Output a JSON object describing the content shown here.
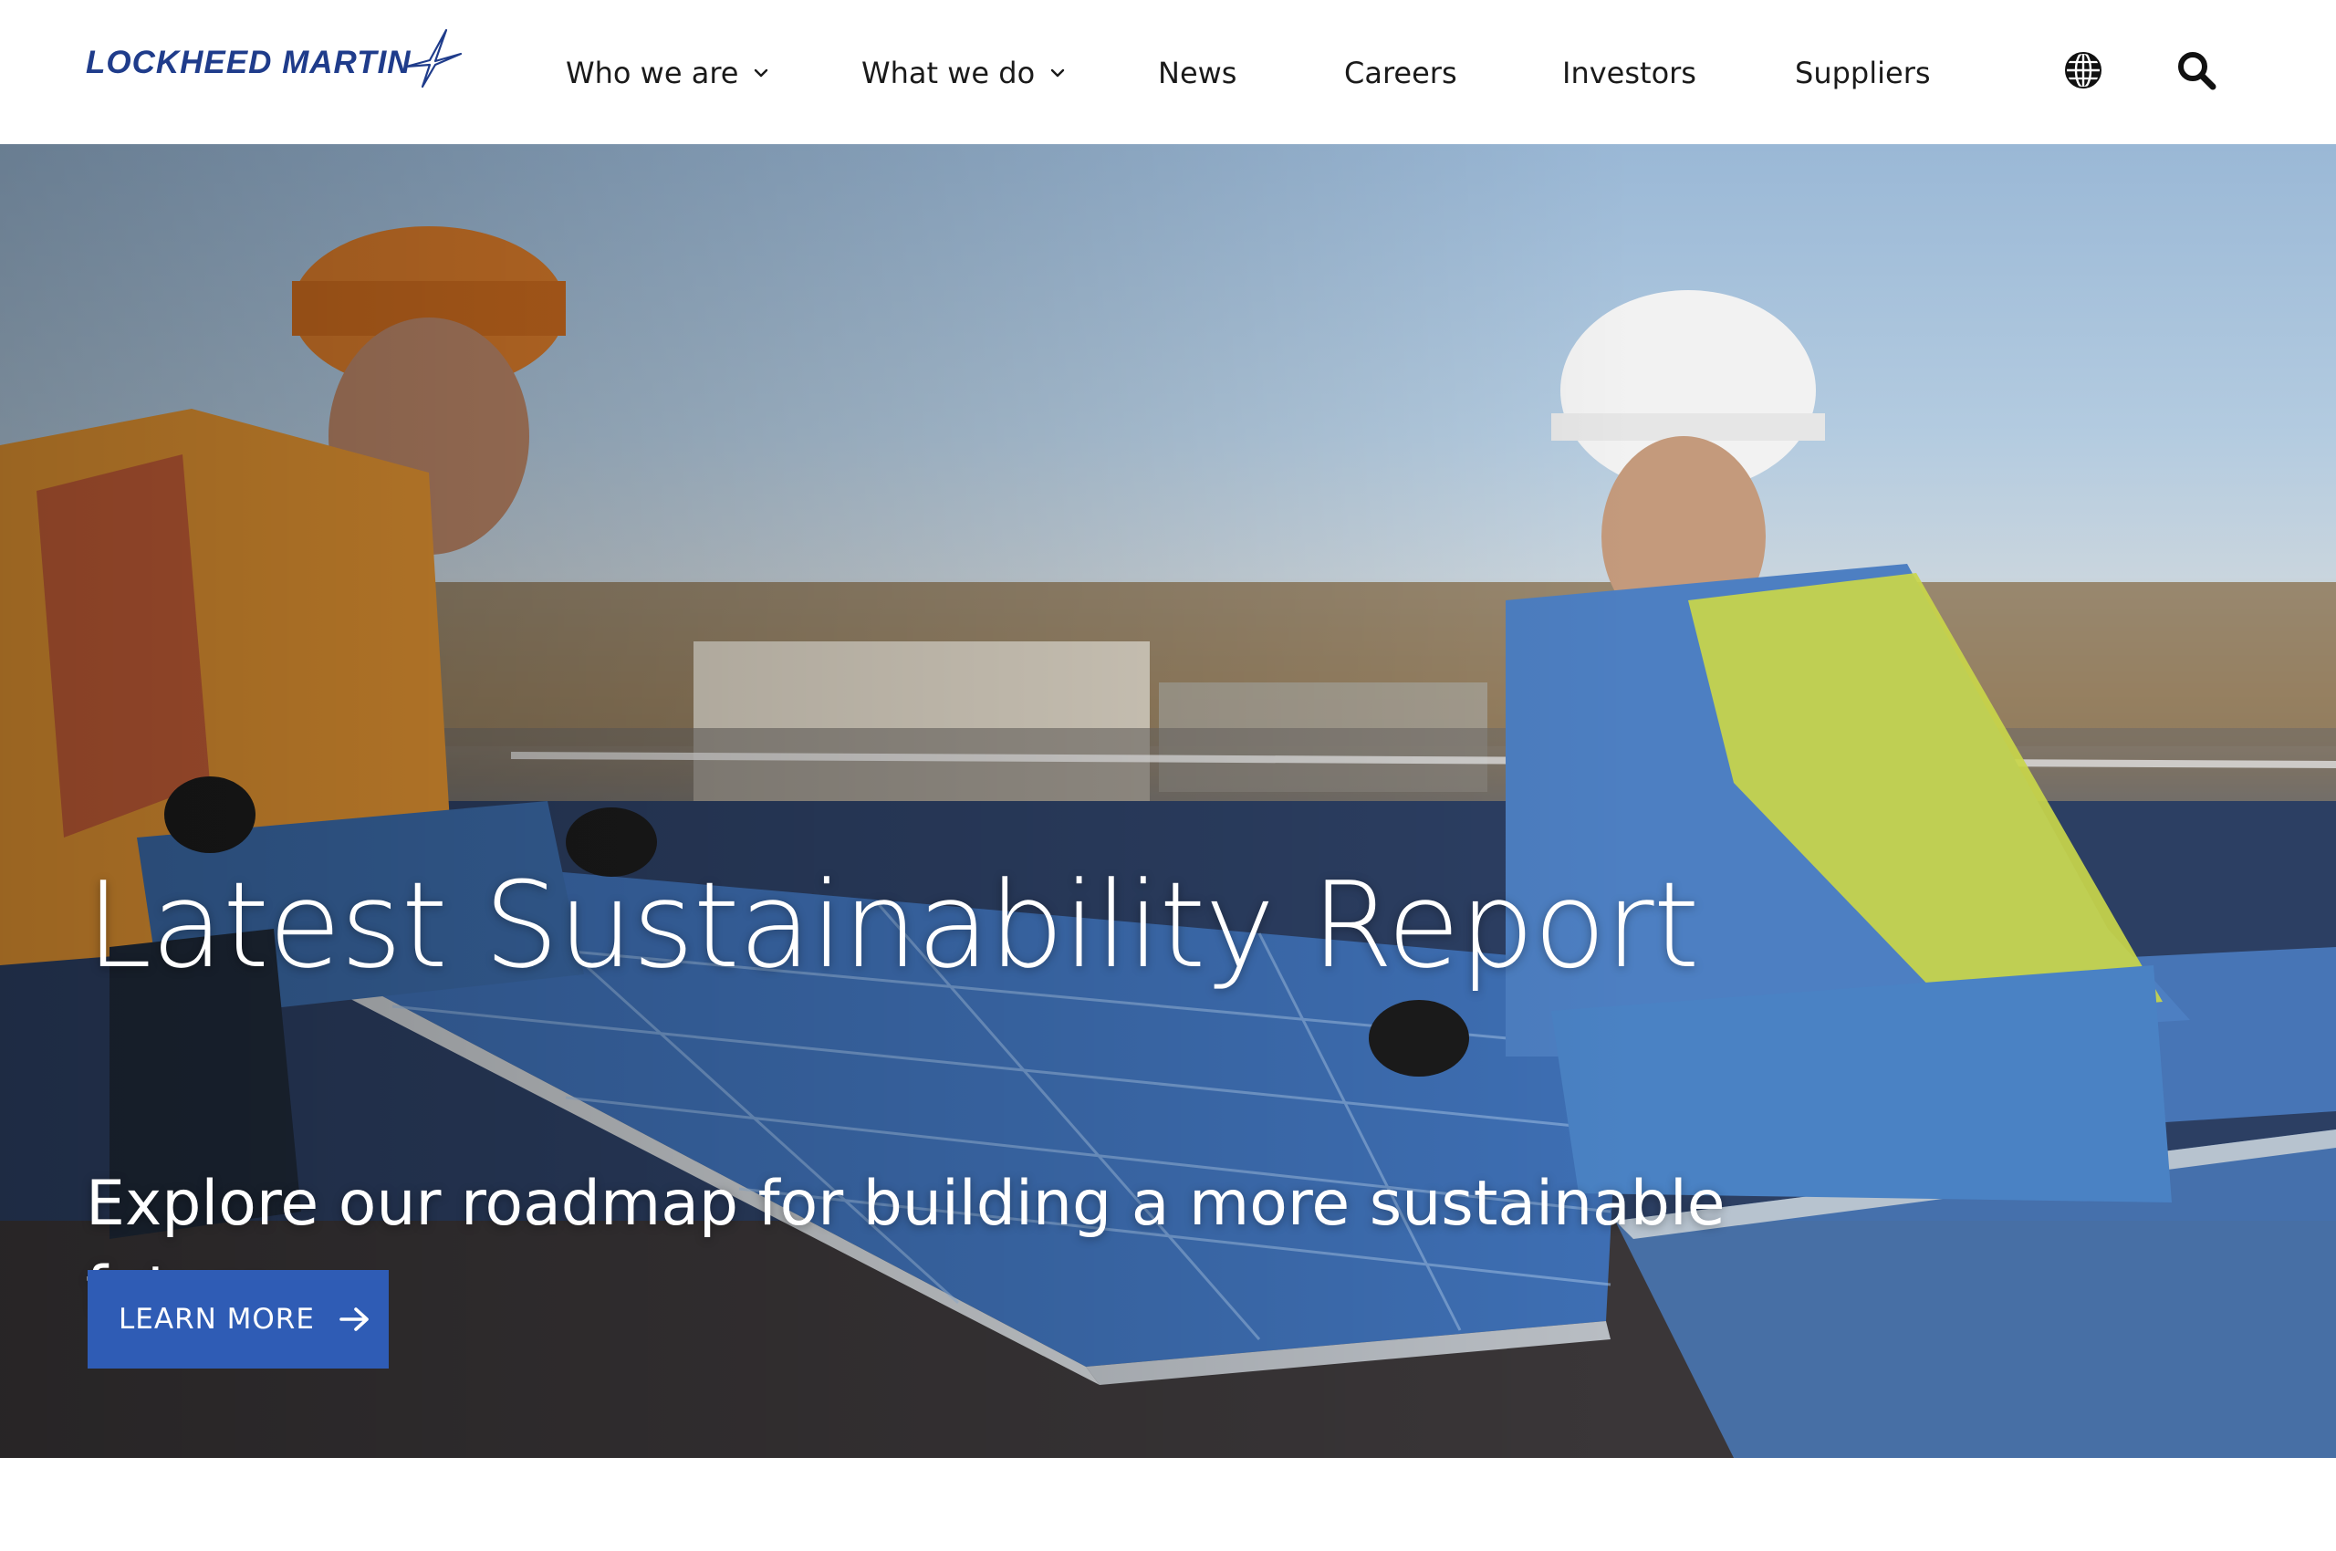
{
  "header": {
    "logo_text": "LOCKHEED MARTIN",
    "nav": {
      "who_we_are": "Who we are",
      "what_we_do": "What we do",
      "news": "News",
      "careers": "Careers",
      "investors": "Investors",
      "suppliers": "Suppliers"
    },
    "icons": {
      "language": "globe-icon",
      "search": "search-icon",
      "dropdown": "chevron-down-icon"
    }
  },
  "hero": {
    "title": "Latest Sustainability Report",
    "subtitle": "Explore our roadmap for building a more sustainable future",
    "cta_label": "LEARN MORE",
    "cta_icon": "arrow-right-icon"
  },
  "colors": {
    "brand_blue": "#1f3c8b",
    "cta_blue": "#2f5cb5",
    "nav_text": "#1a1a1a",
    "hero_text": "#ffffff"
  }
}
